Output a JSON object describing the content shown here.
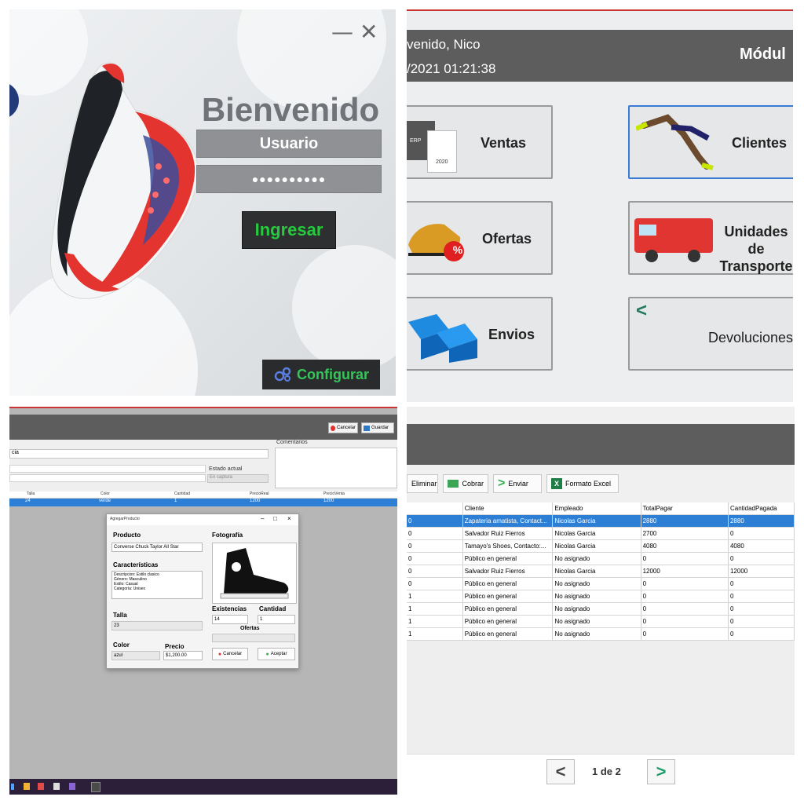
{
  "login": {
    "title": "Bienvenido",
    "username_placeholder": "Usuario",
    "password_mask": "●●●●●●●●●●",
    "login_label": "Ingresar",
    "config_label": "Configurar",
    "minimize": "—",
    "close": "✕"
  },
  "modules": {
    "greeting": "venido, Nico",
    "datetime": "/2021 01:21:38",
    "header_right": "Módul",
    "tiles": {
      "ventas": "Ventas",
      "clientes": "Clientes",
      "ofertas": "Ofertas",
      "unidades_1": "Unidades de",
      "unidades_2": "Transporte",
      "envios": "Envios",
      "devoluciones": "Devoluciones"
    },
    "erp_logo": "ERP",
    "erp_year": "2020",
    "ofertas_badge": "%",
    "back_arrow": "<"
  },
  "sales_form": {
    "cancel_label": "Cancelar",
    "save_label": "Guardar",
    "comments_label": "Comentarios",
    "field_partial": "cia",
    "estado_label": "Estado actual",
    "estado_value": "En captura",
    "columns": [
      "Talla",
      "Color",
      "Cantidad",
      "PrecioReal",
      "PrecioVenta"
    ],
    "row": [
      "24",
      "verde",
      "1",
      "1200",
      "1200"
    ],
    "dialog": {
      "title": "AgregarProducto",
      "producto_label": "Producto",
      "producto_value": "Converse Chuck Taylor All Star",
      "fotografia_label": "Fotografía",
      "caracteristicas_label": "Características",
      "caracteristicas": [
        "Descripcion: Estilo clasico",
        "Género: Masculino",
        "Estilo: Casual",
        "Categoría: Unisex"
      ],
      "talla_label": "Talla",
      "talla_value": "23",
      "existencias_label": "Existencias",
      "existencias_value": "14",
      "cantidad_label": "Cantidad",
      "cantidad_value": "1",
      "ofertas_label": "Ofertas",
      "color_label": "Color",
      "color_value": "azul",
      "precio_label": "Precio",
      "precio_value": "$1,200.00",
      "cancel_label": "Cancelar",
      "accept_label": "Aceptar"
    }
  },
  "table_view": {
    "buttons": {
      "delete": "Eliminar",
      "charge": "Cobrar",
      "send": "Enviar",
      "excel": "Formato Excel"
    },
    "columns": [
      "",
      "Cliente",
      "Empleado",
      "TotalPagar",
      "CantidadPagada"
    ],
    "rows": [
      [
        "0",
        "Zapateria amatista, Contact...",
        "Nicolas Garcia",
        "2880",
        "2880"
      ],
      [
        "0",
        "Salvador Ruiz Fierros",
        "Nicolas Garcia",
        "2700",
        "0"
      ],
      [
        "0",
        "Tamayo's Shoes, Contacto:...",
        "Nicolas Garcia",
        "4080",
        "4080"
      ],
      [
        "0",
        "Público en general",
        "No asignado",
        "0",
        "0"
      ],
      [
        "0",
        "Salvador Ruiz Fierros",
        "Nicolas Garcia",
        "12000",
        "12000"
      ],
      [
        "0",
        "Público en general",
        "No asignado",
        "0",
        "0"
      ],
      [
        "1",
        "Público en general",
        "No asignado",
        "0",
        "0"
      ],
      [
        "1",
        "Público en general",
        "No asignado",
        "0",
        "0"
      ],
      [
        "1",
        "Público en general",
        "No asignado",
        "0",
        "0"
      ],
      [
        "1",
        "Público en general",
        "No asignado",
        "0",
        "0"
      ]
    ],
    "pagination": "1 de 2",
    "prev": "<",
    "next": ">"
  },
  "colors": {
    "accent_green": "#27c93f",
    "header_gray": "#5d5d5e",
    "selection_blue": "#2d7fd6",
    "taskbar": "#2c1f3a"
  }
}
